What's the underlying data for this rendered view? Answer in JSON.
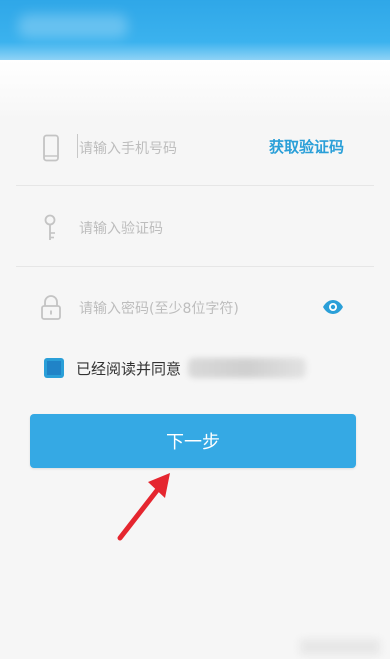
{
  "form": {
    "phone_placeholder": "请输入手机号码",
    "get_code_label": "获取验证码",
    "code_placeholder": "请输入验证码",
    "password_placeholder": "请输入密码(至少8位字符)"
  },
  "agreement": {
    "checked": true,
    "text": "已经阅读并同意"
  },
  "next_button": {
    "label": "下一步"
  },
  "icons": [
    "phone-icon",
    "key-icon",
    "lock-icon",
    "eye-icon",
    "red-arrow-annotation"
  ],
  "colors": {
    "header": "#3bb2ee",
    "accent": "#2a9fd8",
    "button": "#35a9e4",
    "arrow": "#e5262f"
  }
}
